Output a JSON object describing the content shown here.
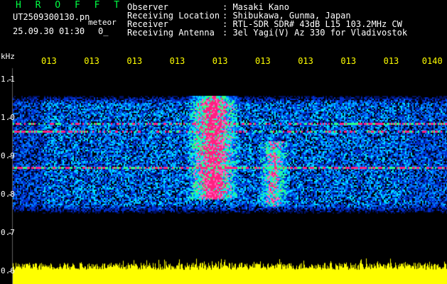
{
  "header": {
    "brand": "H R O F F T",
    "file_name": "UT2509300130.pn",
    "meteor_tag": "meteor",
    "date_time": "25.09.30 01:30",
    "flag": "0_",
    "info": [
      {
        "label": "Observer",
        "value": ": Masaki Kano"
      },
      {
        "label": "Receiving Location",
        "value": ": Shibukawa, Gunma, Japan"
      },
      {
        "label": "Receiver",
        "value": ": RTL-SDR SDR# 43dB L15 103.2MHz CW"
      },
      {
        "label": "Receiving Antenna",
        "value": ": 3el Yagi(V) Az 330 for Vladivostok"
      }
    ]
  },
  "chart_data": {
    "type": "heatmap",
    "title": "",
    "ylabel": "kHz",
    "xlabel": "",
    "x_tick_labels": [
      "013",
      "013",
      "013",
      "013",
      "013",
      "013",
      "013",
      "013",
      "013",
      "0140"
    ],
    "y_ticks": [
      0.6,
      0.7,
      0.8,
      0.9,
      1.0,
      1.1
    ],
    "ylim": [
      0.6,
      1.13
    ],
    "carriers_khz": [
      0.87,
      0.965,
      0.985
    ],
    "meteor_echoes": [
      {
        "x_frac": 0.46,
        "y_range_khz": [
          0.8,
          1.05
        ],
        "intensity": "high"
      },
      {
        "x_frac": 0.6,
        "y_range_khz": [
          0.78,
          0.93
        ],
        "intensity": "medium"
      }
    ],
    "signal_band_khz": [
      0.76,
      1.05
    ],
    "colors": {
      "background": "#000000",
      "noise_low": "#001080",
      "noise_mid": "#00c8ff",
      "peak": "#ff2080",
      "level_bar": "#ffff00"
    }
  }
}
